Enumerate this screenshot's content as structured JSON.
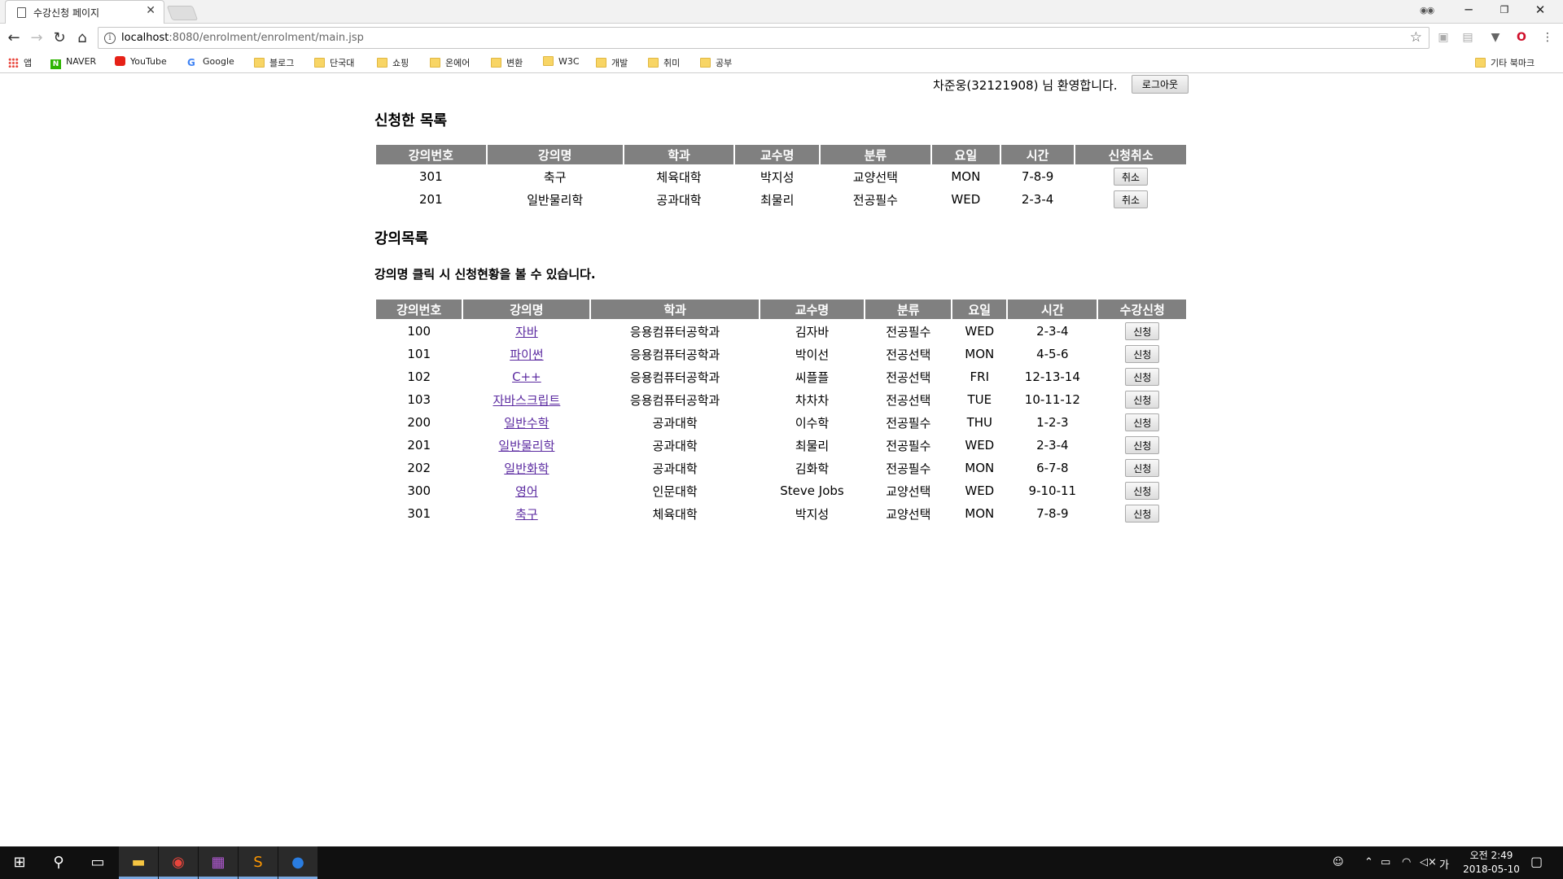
{
  "browser": {
    "tab_title": "수강신청 페이지",
    "url_host": "localhost",
    "url_rest": ":8080/enrolment/enrolment/main.jsp",
    "bookmarks": [
      {
        "label": "앱",
        "icon": "apps-icon"
      },
      {
        "label": "NAVER",
        "icon": "naver-icon"
      },
      {
        "label": "YouTube",
        "icon": "youtube-icon"
      },
      {
        "label": "Google",
        "icon": "google-icon"
      },
      {
        "label": "블로그",
        "icon": "folder-icon"
      },
      {
        "label": "단국대",
        "icon": "folder-icon"
      },
      {
        "label": "쇼핑",
        "icon": "folder-icon"
      },
      {
        "label": "온에어",
        "icon": "folder-icon"
      },
      {
        "label": "변환",
        "icon": "folder-icon"
      },
      {
        "label": "W3C",
        "icon": "folder-icon"
      },
      {
        "label": "개발",
        "icon": "folder-icon"
      },
      {
        "label": "취미",
        "icon": "folder-icon"
      },
      {
        "label": "공부",
        "icon": "folder-icon"
      }
    ],
    "other_bookmarks": "기타 북마크"
  },
  "header": {
    "welcome": "차준웅(32121908) 님 환영합니다.",
    "logout_label": "로그아웃"
  },
  "applied": {
    "title": "신청한 목록",
    "columns": [
      "강의번호",
      "강의명",
      "학과",
      "교수명",
      "분류",
      "요일",
      "시간",
      "신청취소"
    ],
    "rows": [
      {
        "id": "301",
        "name": "축구",
        "dept": "체육대학",
        "prof": "박지성",
        "type": "교양선택",
        "day": "MON",
        "time": "7-8-9",
        "action": "취소"
      },
      {
        "id": "201",
        "name": "일반물리학",
        "dept": "공과대학",
        "prof": "최물리",
        "type": "전공필수",
        "day": "WED",
        "time": "2-3-4",
        "action": "취소"
      }
    ]
  },
  "courses": {
    "title": "강의목록",
    "notice": "강의명 클릭 시 신청현황을 볼 수 있습니다.",
    "columns": [
      "강의번호",
      "강의명",
      "학과",
      "교수명",
      "분류",
      "요일",
      "시간",
      "수강신청"
    ],
    "rows": [
      {
        "id": "100",
        "name": "자바",
        "dept": "응용컴퓨터공학과",
        "prof": "김자바",
        "type": "전공필수",
        "day": "WED",
        "time": "2-3-4",
        "action": "신청"
      },
      {
        "id": "101",
        "name": "파이썬",
        "dept": "응용컴퓨터공학과",
        "prof": "박이선",
        "type": "전공선택",
        "day": "MON",
        "time": "4-5-6",
        "action": "신청"
      },
      {
        "id": "102",
        "name": "C++",
        "dept": "응용컴퓨터공학과",
        "prof": "씨플플",
        "type": "전공선택",
        "day": "FRI",
        "time": "12-13-14",
        "action": "신청"
      },
      {
        "id": "103",
        "name": "자바스크립트",
        "dept": "응용컴퓨터공학과",
        "prof": "차차차",
        "type": "전공선택",
        "day": "TUE",
        "time": "10-11-12",
        "action": "신청"
      },
      {
        "id": "200",
        "name": "일반수학",
        "dept": "공과대학",
        "prof": "이수학",
        "type": "전공필수",
        "day": "THU",
        "time": "1-2-3",
        "action": "신청"
      },
      {
        "id": "201",
        "name": "일반물리학",
        "dept": "공과대학",
        "prof": "최물리",
        "type": "전공필수",
        "day": "WED",
        "time": "2-3-4",
        "action": "신청"
      },
      {
        "id": "202",
        "name": "일반화학",
        "dept": "공과대학",
        "prof": "김화학",
        "type": "전공필수",
        "day": "MON",
        "time": "6-7-8",
        "action": "신청"
      },
      {
        "id": "300",
        "name": "영어",
        "dept": "인문대학",
        "prof": "Steve Jobs",
        "type": "교양선택",
        "day": "WED",
        "time": "9-10-11",
        "action": "신청"
      },
      {
        "id": "301",
        "name": "축구",
        "dept": "체육대학",
        "prof": "박지성",
        "type": "교양선택",
        "day": "MON",
        "time": "7-8-9",
        "action": "신청"
      }
    ]
  },
  "taskbar": {
    "time": "오전 2:49",
    "date": "2018-05-10",
    "ime": "가"
  }
}
